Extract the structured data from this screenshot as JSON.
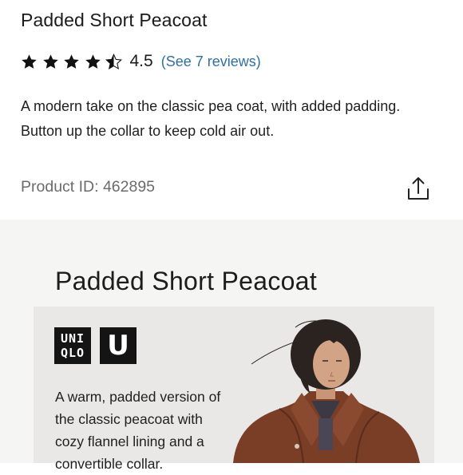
{
  "product": {
    "title": "Padded Short Peacoat",
    "rating": "4.5",
    "rating_stars": 4.5,
    "reviews_link": "(See 7 reviews)",
    "description": "A modern take on the classic pea coat, with added padding. Button up the collar to keep cold air out.",
    "product_id": "Product ID: 462895",
    "share_icon": "share-icon"
  },
  "banner": {
    "title": "Padded Short Peacoat",
    "logo_uniqlo_line1": "UNI",
    "logo_uniqlo_line2": "QLO",
    "logo_u": "U",
    "text": "A warm, padded version of the classic peacoat with cozy flannel lining and a convertible collar.",
    "image": "model-wearing-peacoat"
  },
  "colors": {
    "link": "#2f6fa6",
    "banner_background": "#f5f5f4",
    "card_background": "#e9e8e6",
    "coat": "#7a3d26"
  }
}
